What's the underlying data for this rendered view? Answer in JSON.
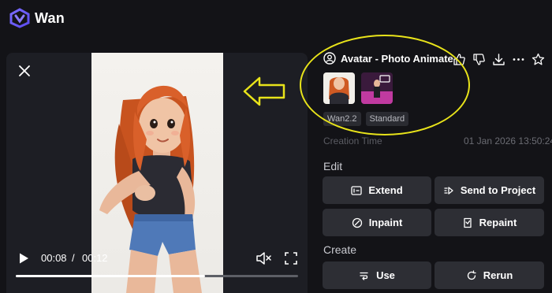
{
  "header": {
    "brand": "Wan"
  },
  "player": {
    "current_time": "00:08",
    "separator": "/",
    "total_time": "00:12",
    "progress": 0.67
  },
  "detail": {
    "title": "Avatar - Photo Animate",
    "tags": [
      "Wan2.2",
      "Standard"
    ],
    "creation_label": "Creation Time",
    "creation_value": "01 Jan 2026 13:50:24"
  },
  "edit": {
    "heading": "Edit",
    "extend": "Extend",
    "send_to_project": "Send to Project",
    "inpaint": "Inpaint",
    "repaint": "Repaint"
  },
  "create": {
    "heading": "Create",
    "use": "Use",
    "rerun": "Rerun"
  },
  "colors": {
    "background": "#131317",
    "panel": "#1d1e24",
    "button": "#2d2e34",
    "annotation": "#e8e31a",
    "accent": "#8a7cff"
  },
  "icons": [
    "wan-logo-icon",
    "close-icon",
    "play-icon",
    "mute-icon",
    "fullscreen-icon",
    "avatar-icon",
    "thumbs-up-icon",
    "thumbs-down-icon",
    "download-icon",
    "more-icon",
    "star-icon",
    "extend-icon",
    "send-icon",
    "inpaint-icon",
    "repaint-icon",
    "use-icon",
    "rerun-icon"
  ]
}
